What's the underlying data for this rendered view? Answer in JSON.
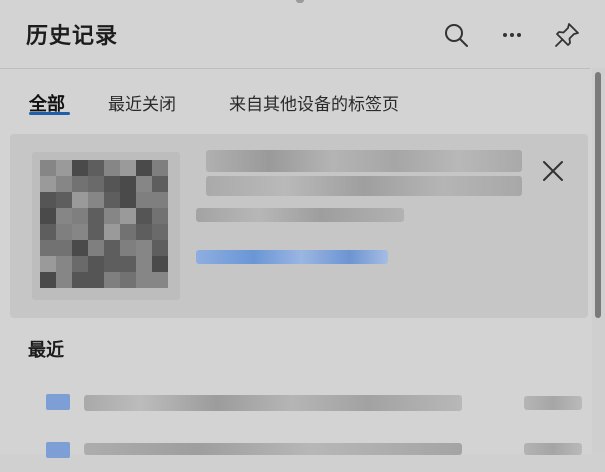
{
  "header": {
    "title": "历史记录",
    "actions": [
      {
        "name": "search",
        "icon": "search-icon"
      },
      {
        "name": "more",
        "icon": "more-icon"
      },
      {
        "name": "pin",
        "icon": "pin-icon"
      }
    ]
  },
  "tabs": [
    {
      "label": "全部",
      "active": true
    },
    {
      "label": "最近关闭",
      "active": false
    },
    {
      "label": "来自其他设备的标签页",
      "active": false
    }
  ],
  "featured_card": {
    "thumbnail": "pixelated-thumbnail",
    "close_icon": "close-icon"
  },
  "recent": {
    "title": "最近"
  },
  "colors": {
    "background": "#d3d3d3",
    "accent": "#1f5fa8",
    "card": "#c6c6c6",
    "link": "#6a96d6"
  }
}
